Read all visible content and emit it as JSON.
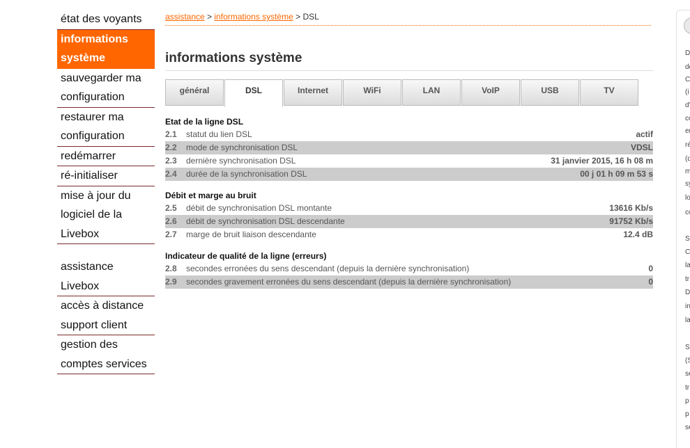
{
  "nav": {
    "group1": [
      {
        "label": "état des voyants",
        "lines": 1
      },
      {
        "label": "informations système",
        "lines": 2,
        "active": true
      },
      {
        "label": "sauvegarder ma configuration",
        "lines": 2
      },
      {
        "label": "restaurer ma configuration",
        "lines": 2
      },
      {
        "label": "redémarrer",
        "lines": 1
      },
      {
        "label": "ré-initialiser",
        "lines": 1
      },
      {
        "label": "mise à jour du logiciel de la Livebox",
        "lines": 3
      }
    ],
    "group2": [
      {
        "label": "assistance Livebox",
        "lines": 2
      },
      {
        "label": "accès à distance support client",
        "lines": 2
      },
      {
        "label": "gestion des comptes services",
        "lines": 2
      }
    ]
  },
  "breadcrumb": {
    "link1": "assistance",
    "sep1": " > ",
    "link2": "informations système",
    "sep2": " > ",
    "current": "DSL"
  },
  "page_title": "informations système",
  "tabs": [
    {
      "label": "général"
    },
    {
      "label": "DSL",
      "active": true
    },
    {
      "label": "Internet"
    },
    {
      "label": "WiFi"
    },
    {
      "label": "LAN"
    },
    {
      "label": "VoIP"
    },
    {
      "label": "USB"
    },
    {
      "label": "TV"
    }
  ],
  "sections": [
    {
      "title": "Etat de la ligne DSL",
      "rows": [
        {
          "num": "2.1",
          "label": "statut du lien DSL",
          "value": "actif"
        },
        {
          "num": "2.2",
          "label": "mode de synchronisation DSL",
          "value": "VDSL"
        },
        {
          "num": "2.3",
          "label": "dernière synchronisation DSL",
          "value": "31 janvier 2015, 16 h 08 m"
        },
        {
          "num": "2.4",
          "label": "durée de la synchronisation DSL",
          "value": "00 j 01 h 09 m 53 s"
        }
      ]
    },
    {
      "title": "Débit et marge au bruit",
      "rows": [
        {
          "num": "2.5",
          "label": "débit de synchronisation DSL montante",
          "value": "13616 Kb/s"
        },
        {
          "num": "2.6",
          "label": "débit de synchronisation DSL descendante",
          "value": "91752 Kb/s"
        },
        {
          "num": "2.7",
          "label": "marge de bruit liaison descendante",
          "value": "12.4 dB"
        }
      ]
    },
    {
      "title": "Indicateur de qualité de la ligne (erreurs)",
      "rows": [
        {
          "num": "2.8",
          "label": "secondes erronées du sens descendant (depuis la dernière synchronisation)",
          "value": "0"
        },
        {
          "num": "2.9",
          "label": "secondes gravement erronées du sens descendant (depuis la dernière synchronisation)",
          "value": "0"
        }
      ]
    }
  ],
  "right_panel": {
    "fragments": [
      "D",
      "de",
      "C",
      "(i",
      "d'",
      "co",
      "er",
      "ré",
      "(d",
      "m",
      "sy",
      "lo",
      "co",
      "S",
      "C",
      "la",
      "tr",
      "D",
      "in",
      "la",
      "S",
      "(S",
      "se",
      "tr",
      "p",
      "p",
      "se"
    ]
  },
  "colors": {
    "accent": "#ff6600",
    "row_shade": "#cccccc",
    "nav_border": "#7a2a2a"
  }
}
